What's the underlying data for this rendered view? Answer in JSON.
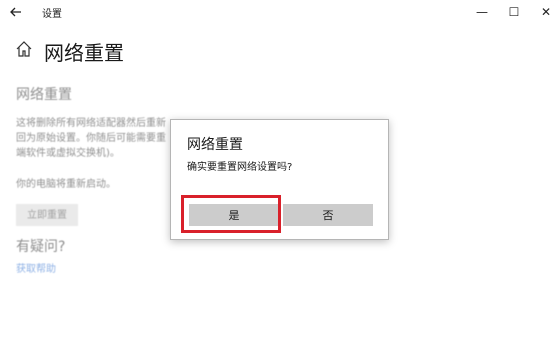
{
  "window": {
    "title": "设置",
    "back_icon": "back-arrow-icon",
    "minimize": "—",
    "maximize": "☐",
    "close": "✕"
  },
  "page": {
    "home_icon": "home-icon",
    "title": "网络重置"
  },
  "section": {
    "heading": "网络重置",
    "line1": "这将删除所有网络适配器然后重新",
    "line2": "回为原始设置。你随后可能需要重",
    "line3": "端软件或虚拟交换机)。",
    "restart_note": "你的电脑将重新启动。",
    "reset_button": "立即重置",
    "question": "有疑问?",
    "help_link": "获取帮助"
  },
  "dialog": {
    "title": "网络重置",
    "message": "确实要重置网络设置吗?",
    "yes_label": "是",
    "no_label": "否"
  },
  "colors": {
    "highlight": "#d9202a",
    "link": "#2f6fcf",
    "button_bg": "#cccccc"
  }
}
